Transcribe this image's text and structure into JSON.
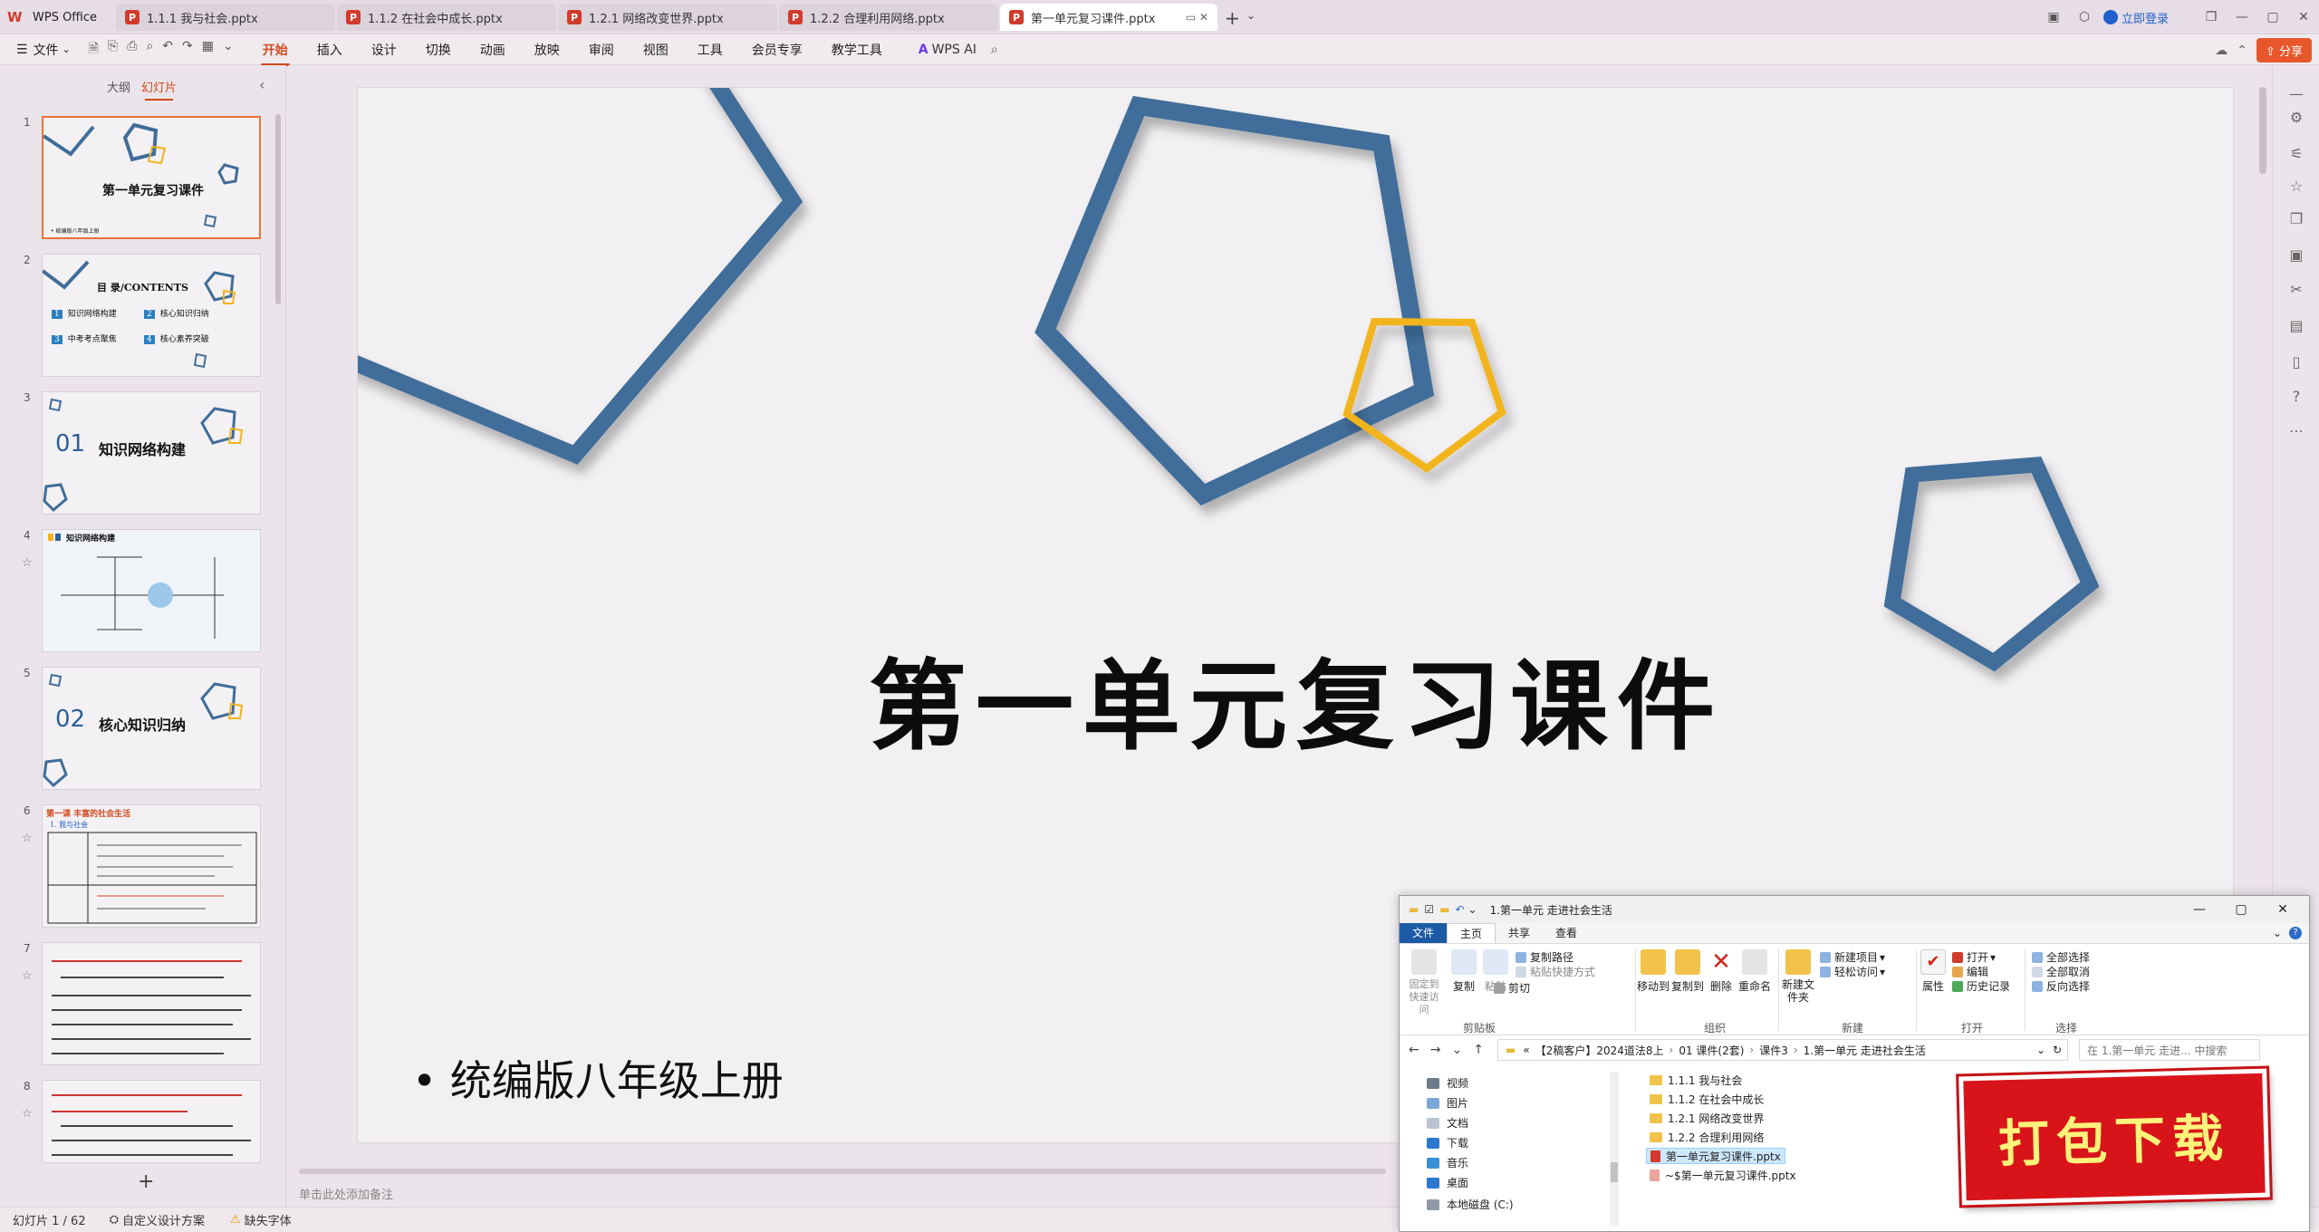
{
  "titlebar": {
    "home_label": "WPS Office",
    "tabs": [
      {
        "label": "1.1.1 我与社会.pptx"
      },
      {
        "label": "1.1.2 在社会中成长.pptx"
      },
      {
        "label": "1.2.1 网络改变世界.pptx"
      },
      {
        "label": "1.2.2 合理利用网络.pptx"
      },
      {
        "label": "第一单元复习课件.pptx"
      }
    ],
    "login_label": "立即登录"
  },
  "menubar": {
    "file_label": "文件",
    "items": [
      "开始",
      "插入",
      "设计",
      "切换",
      "动画",
      "放映",
      "审阅",
      "视图",
      "工具",
      "会员专享",
      "教学工具"
    ],
    "active": "开始",
    "ai_label": "WPS AI",
    "share_label": "分享"
  },
  "leftpanel": {
    "tab_outline": "大纲",
    "tab_slides": "幻灯片",
    "thumbs": [
      {
        "num": "1",
        "title": "第一单元复习课件",
        "sub": "• 统编版八年级上册"
      },
      {
        "num": "2",
        "title": "目 录/CONTENTS",
        "items": [
          "知识网络构建",
          "核心知识归纳",
          "中考考点聚焦",
          "核心素养突破"
        ]
      },
      {
        "num": "3",
        "big": "01",
        "title": "知识网络构建"
      },
      {
        "num": "4",
        "title": "知识网络构建"
      },
      {
        "num": "5",
        "big": "02",
        "title": "核心知识归纳"
      },
      {
        "num": "6",
        "title": "第一课 丰富的社会生活",
        "sub": "1. 我与社会"
      },
      {
        "num": "7",
        "title": ""
      },
      {
        "num": "8",
        "title": ""
      }
    ]
  },
  "slide": {
    "title": "第一单元复习课件",
    "subtitle": "• 统编版八年级上册",
    "notes_placeholder": "单击此处添加备注"
  },
  "statusbar": {
    "slide_info": "幻灯片 1 / 62",
    "design": "自定义设计方案",
    "missing_font": "缺失字体"
  },
  "explorer": {
    "title": "1.第一单元 走进社会生活",
    "ribbon_tabs": [
      "文件",
      "主页",
      "共享",
      "查看"
    ],
    "ribbon": {
      "pin": "固定到快速访问",
      "copy": "复制",
      "paste": "粘贴",
      "copy_path": "复制路径",
      "paste_shortcut": "粘贴快捷方式",
      "cut": "剪切",
      "move_to": "移动到",
      "copy_to": "复制到",
      "delete": "删除",
      "rename": "重命名",
      "new_folder": "新建文件夹",
      "new_item": "新建项目",
      "easy_access": "轻松访问",
      "properties": "属性",
      "open": "打开",
      "edit": "编辑",
      "history": "历史记录",
      "select_all": "全部选择",
      "select_none": "全部取消",
      "invert": "反向选择",
      "groups": [
        "剪贴板",
        "组织",
        "新建",
        "打开",
        "选择"
      ]
    },
    "path": [
      "«",
      "【2稿客户】2024道法8上",
      "01 课件(2套)",
      "课件3",
      "1.第一单元 走进社会生活"
    ],
    "search_placeholder": "在 1.第一单元 走进... 中搜索",
    "nav": [
      "视频",
      "图片",
      "文档",
      "下载",
      "音乐",
      "桌面",
      "本地磁盘 (C:)"
    ],
    "files": [
      {
        "name": "1.1.1 我与社会",
        "type": "folder"
      },
      {
        "name": "1.1.2 在社会中成长",
        "type": "folder"
      },
      {
        "name": "1.2.1 网络改变世界",
        "type": "folder"
      },
      {
        "name": "1.2.2 合理利用网络",
        "type": "folder"
      },
      {
        "name": "第一单元复习课件.pptx",
        "type": "ppt",
        "selected": true
      },
      {
        "name": "~$第一单元复习课件.pptx",
        "type": "tmp"
      }
    ]
  },
  "banner": {
    "label": "打包下载"
  },
  "colors": {
    "accent": "#d24a1d",
    "pentagon_blue": "#3f6d9a",
    "pentagon_gold": "#f2b41f",
    "banner_red": "#d8141a"
  }
}
